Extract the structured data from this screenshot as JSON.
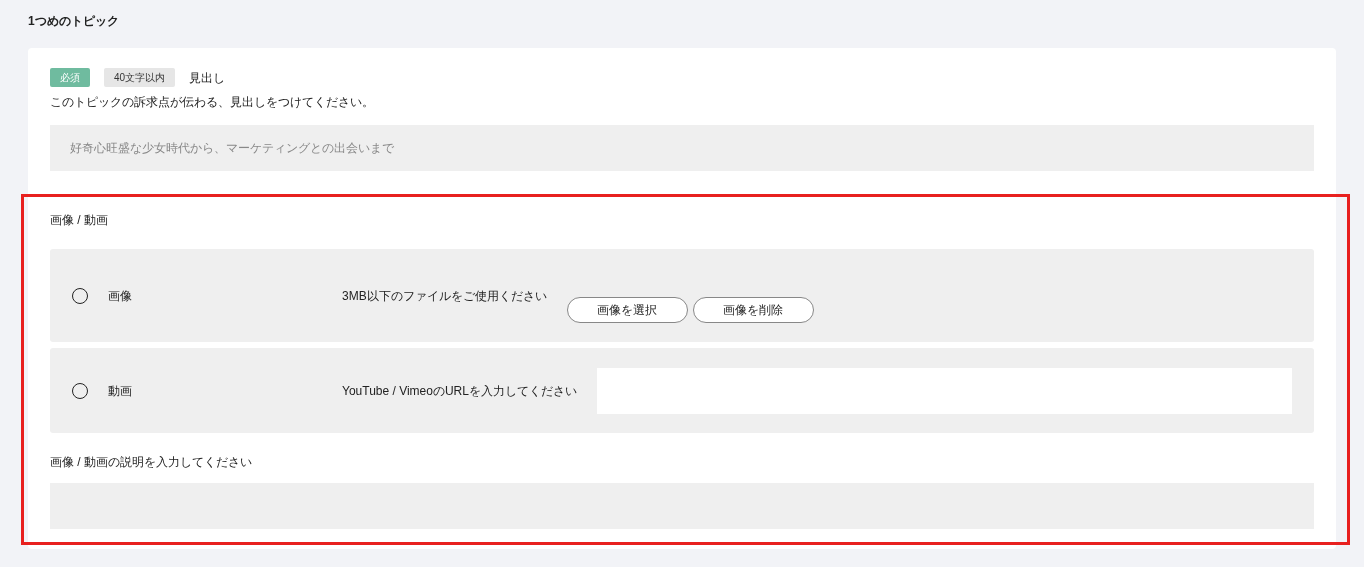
{
  "section_title": "1つめのトピック",
  "heading_field": {
    "badges": [
      {
        "label": "必須",
        "kind": "required"
      },
      {
        "label": "40文字以内",
        "kind": "limit"
      }
    ],
    "label": "見出し",
    "description": "このトピックの訴求点が伝わる、見出しをつけてください。",
    "placeholder": "好奇心旺盛な少女時代から、マーケティングとの出会いまで"
  },
  "media": {
    "title": "画像 / 動画",
    "options": [
      {
        "kind": "image",
        "label": "画像",
        "selected": false,
        "hint": "3MB以下のファイルをご使用ください",
        "buttons": [
          "画像を選択",
          "画像を削除"
        ]
      },
      {
        "kind": "video",
        "label": "動画",
        "selected": false,
        "hint": "YouTube / VimeoのURLを入力してください"
      }
    ],
    "caption_label": "画像 / 動画の説明を入力してください"
  }
}
